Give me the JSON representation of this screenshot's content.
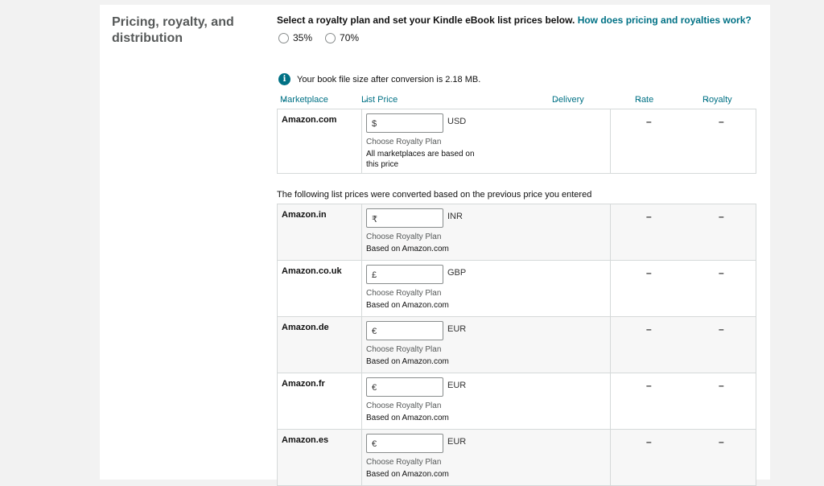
{
  "section": {
    "title": "Pricing, royalty, and distribution"
  },
  "intro": {
    "text": "Select a royalty plan and set your Kindle eBook list prices below.",
    "link": "How does pricing and royalties work?"
  },
  "royalty_options": [
    "35%",
    "70%"
  ],
  "info": {
    "icon": "info-icon",
    "text": "Your book file size after conversion is 2.18 MB."
  },
  "columns": {
    "marketplace": "Marketplace",
    "list_price": "List Price",
    "delivery": "Delivery",
    "rate": "Rate",
    "royalty": "Royalty"
  },
  "primary": {
    "name": "Amazon.com",
    "symbol": "$",
    "currency": "USD",
    "plan": "Choose Royalty Plan",
    "note": "All marketplaces are based on this price",
    "rate": "–",
    "royalty": "–"
  },
  "converted_note": "The following list prices were converted based on the previous price you entered",
  "markets": [
    {
      "name": "Amazon.in",
      "symbol": "₹",
      "currency": "INR",
      "plan": "Choose Royalty Plan",
      "note": "Based on Amazon.com",
      "rate": "–",
      "royalty": "–"
    },
    {
      "name": "Amazon.co.uk",
      "symbol": "£",
      "currency": "GBP",
      "plan": "Choose Royalty Plan",
      "note": "Based on Amazon.com",
      "rate": "–",
      "royalty": "–"
    },
    {
      "name": "Amazon.de",
      "symbol": "€",
      "currency": "EUR",
      "plan": "Choose Royalty Plan",
      "note": "Based on Amazon.com",
      "rate": "–",
      "royalty": "–"
    },
    {
      "name": "Amazon.fr",
      "symbol": "€",
      "currency": "EUR",
      "plan": "Choose Royalty Plan",
      "note": "Based on Amazon.com",
      "rate": "–",
      "royalty": "–"
    },
    {
      "name": "Amazon.es",
      "symbol": "€",
      "currency": "EUR",
      "plan": "Choose Royalty Plan",
      "note": "Based on Amazon.com",
      "rate": "–",
      "royalty": "–"
    }
  ]
}
